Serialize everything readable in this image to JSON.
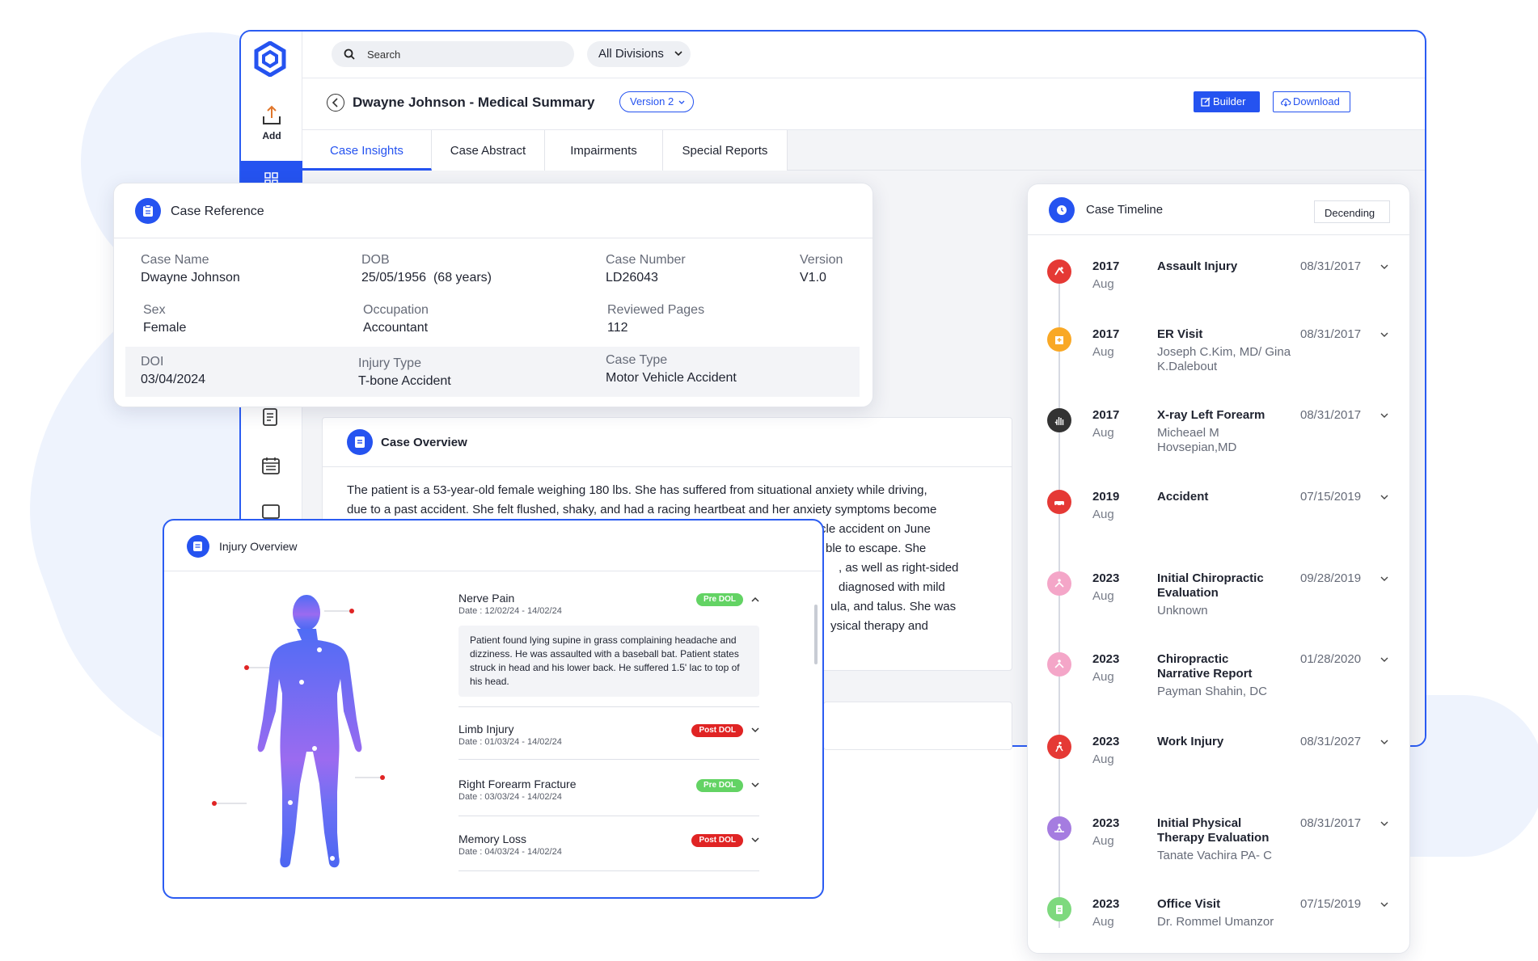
{
  "app": {
    "add_label": "Add",
    "search_placeholder": "Search",
    "division_select": "All Divisions",
    "page_title": "Dwayne Johnson - Medical Summary",
    "version_select": "Version 2",
    "builder_label": "Builder",
    "download_label": "Download",
    "tabs": [
      {
        "label": "Case Insights",
        "active": true
      },
      {
        "label": "Case Abstract",
        "active": false
      },
      {
        "label": "Impairments",
        "active": false
      },
      {
        "label": "Special Reports",
        "active": false
      }
    ],
    "accent_color": "#2553f0"
  },
  "case_reference": {
    "title": "Case Reference",
    "fields": {
      "case_name": {
        "label": "Case Name",
        "value": "Dwayne Johnson"
      },
      "dob": {
        "label": "DOB",
        "value": "25/05/1956  (68 years)"
      },
      "case_number": {
        "label": "Case Number",
        "value": "LD26043"
      },
      "version": {
        "label": "Version",
        "value": "V1.0"
      },
      "sex": {
        "label": "Sex",
        "value": "Female"
      },
      "occupation": {
        "label": "Occupation",
        "value": "Accountant"
      },
      "reviewed_pages": {
        "label": "Reviewed Pages",
        "value": "112"
      },
      "doi": {
        "label": "DOI",
        "value": "03/04/2024"
      },
      "injury_type": {
        "label": "Injury Type",
        "value": "T-bone Accident"
      },
      "case_type": {
        "label": "Case Type",
        "value": "Motor Vehicle Accident"
      }
    }
  },
  "case_overview": {
    "title": "Case Overview",
    "line1": "The patient is a 53-year-old female weighing 180 lbs. She has suffered from situational anxiety while driving,",
    "line2": "due to a past accident. She felt flushed, shaky, and had a racing heartbeat and her anxiety symptoms become",
    "frag3": "or vehicle accident on June",
    "frag4": "ble to escape. She",
    "frag5": ", as well as right-sided",
    "frag6": "diagnosed with mild",
    "frag7": "ula, and talus. She was",
    "frag8": "ysical therapy and"
  },
  "injury_overview": {
    "title": "Injury Overview",
    "items": [
      {
        "title": "Nerve Pain",
        "date": "Date : 12/02/24 - 14/02/24",
        "badge": "Pre DOL",
        "detail": "Patient found lying supine in grass complaining headache and dizziness. He was assaulted with a baseball bat. Patient states struck in head and his lower back. He suffered 1.5' lac to top of his head."
      },
      {
        "title": "Limb Injury",
        "date": "Date : 01/03/24 - 14/02/24",
        "badge": "Post DOL"
      },
      {
        "title": "Right Forearm Fracture",
        "date": "Date : 03/03/24 - 14/02/24",
        "badge": "Pre DOL"
      },
      {
        "title": "Memory Loss",
        "date": "Date : 04/03/24 - 14/02/24",
        "badge": "Post DOL"
      }
    ]
  },
  "timeline": {
    "title": "Case Timeline",
    "sort": "Decending",
    "events": [
      {
        "year": "2017",
        "month": "Aug",
        "title": "Assault Injury",
        "sub": "",
        "date": "08/31/2017",
        "color": "#e53935",
        "icon": "assault-icon"
      },
      {
        "year": "2017",
        "month": "Aug",
        "title": "ER Visit",
        "sub": "Joseph C.Kim, MD/ Gina K.Dalebout",
        "date": "08/31/2017",
        "color": "#f9a825",
        "icon": "hospital-icon"
      },
      {
        "year": "2017",
        "month": "Aug",
        "title": "X-ray Left Forearm",
        "sub": "Micheael M Hovsepian,MD",
        "date": "08/31/2017",
        "color": "#333333",
        "icon": "xray-hand-icon"
      },
      {
        "year": "2019",
        "month": "Aug",
        "title": "Accident",
        "sub": "",
        "date": "07/15/2019",
        "color": "#e53935",
        "icon": "car-crash-icon"
      },
      {
        "year": "2023",
        "month": "Aug",
        "title": "Initial Chiropractic Evaluation",
        "sub": "Unknown",
        "date": "09/28/2019",
        "color": "#f4a6c8",
        "icon": "chiropractic-icon"
      },
      {
        "year": "2023",
        "month": "Aug",
        "title": "Chiropractic Narrative Report",
        "sub": "Payman Shahin, DC",
        "date": "01/28/2020",
        "color": "#f4a6c8",
        "icon": "chiropractic-icon"
      },
      {
        "year": "2023",
        "month": "Aug",
        "title": "Work Injury",
        "sub": "",
        "date": "08/31/2027",
        "color": "#e53935",
        "icon": "work-injury-icon"
      },
      {
        "year": "2023",
        "month": "Aug",
        "title": "Initial Physical Therapy Evaluation",
        "sub": "Tanate Vachira PA- C",
        "date": "08/31/2017",
        "color": "#a57ce0",
        "icon": "physical-therapy-icon"
      },
      {
        "year": "2023",
        "month": "Aug",
        "title": "Office Visit",
        "sub": "Dr. Rommel Umanzor",
        "date": "07/15/2019",
        "color": "#7ed97e",
        "icon": "clipboard-icon"
      }
    ]
  }
}
